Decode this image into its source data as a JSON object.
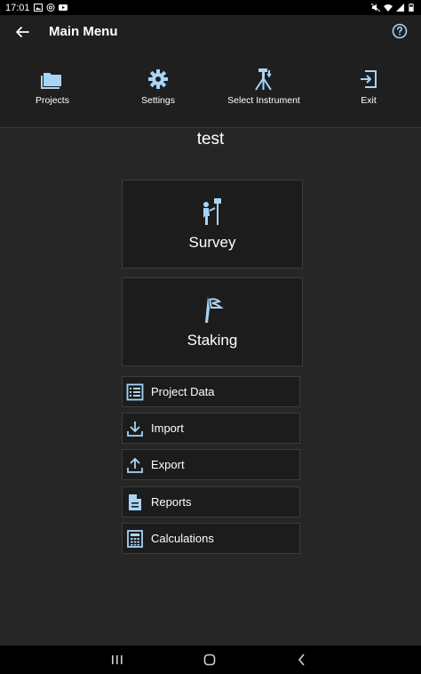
{
  "status_bar": {
    "time": "17:01"
  },
  "app_bar": {
    "title": "Main Menu",
    "back_icon": "arrow-left-icon",
    "help_icon": "help-circle-icon"
  },
  "toolbar": [
    {
      "label": "Projects",
      "icon": "folder-icon"
    },
    {
      "label": "Settings",
      "icon": "gear-icon"
    },
    {
      "label": "Select Instrument",
      "icon": "tripod-icon"
    },
    {
      "label": "Exit",
      "icon": "exit-icon"
    }
  ],
  "project": {
    "name": "test"
  },
  "tiles": [
    {
      "label": "Survey",
      "icon": "surveyor-icon"
    },
    {
      "label": "Staking",
      "icon": "stake-flag-icon"
    }
  ],
  "menu": [
    {
      "label": "Project Data",
      "icon": "list-icon"
    },
    {
      "label": "Import",
      "icon": "download-icon"
    },
    {
      "label": "Export",
      "icon": "upload-icon"
    },
    {
      "label": "Reports",
      "icon": "document-icon"
    },
    {
      "label": "Calculations",
      "icon": "calculator-icon"
    }
  ],
  "colors": {
    "accent_icon": "#a8d4f5",
    "background": "#262626",
    "app_bar": "#1f1f1f"
  }
}
